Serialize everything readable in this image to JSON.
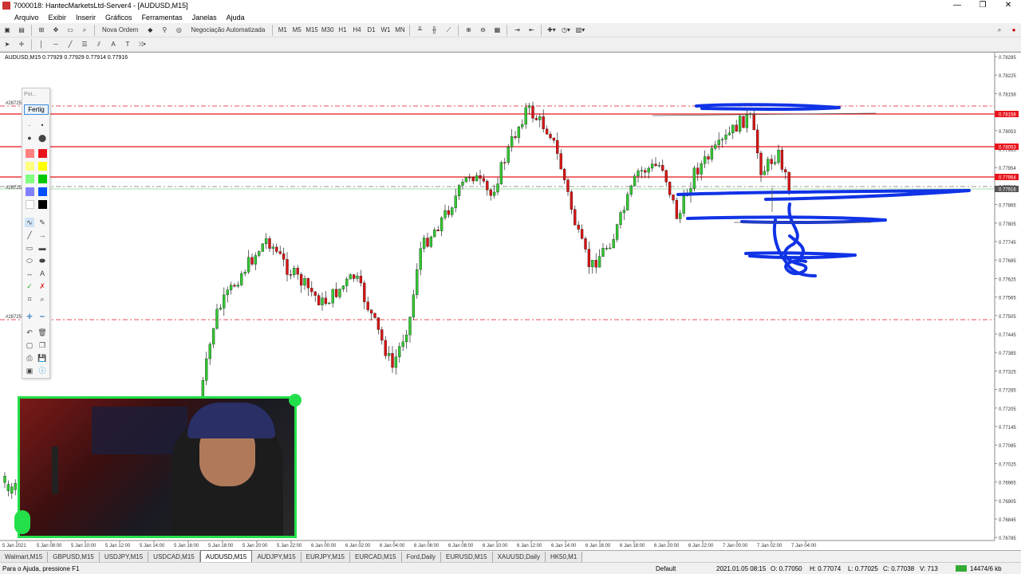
{
  "window": {
    "title": "7000018: HantecMarketsLtd-Server4 - [AUDUSD,M15]",
    "controls": [
      "—",
      "❐",
      "✕"
    ]
  },
  "menu": [
    "Arquivo",
    "Exibir",
    "Inserir",
    "Gráficos",
    "Ferramentas",
    "Janelas",
    "Ajuda"
  ],
  "toolbar": {
    "new_order": "Nova Ordem",
    "auto_trading": "Negociação Automatizada",
    "timeframes": [
      "M1",
      "M5",
      "M15",
      "M30",
      "H1",
      "H4",
      "D1",
      "W1",
      "MN"
    ]
  },
  "chart": {
    "header": "AUDUSD,M15  0.77929 0.77929 0.77914 0.77916",
    "price_labels": [
      "0.78285",
      "0.78225",
      "0.78158",
      "0.78105",
      "0.78053",
      "0.77985",
      "0.77954",
      "0.77916",
      "0.77865",
      "0.77805",
      "0.77745",
      "0.77685",
      "0.77625",
      "0.77565",
      "0.77505",
      "0.77445",
      "0.77385",
      "0.77325",
      "0.77265",
      "0.77205",
      "0.77145",
      "0.77085",
      "0.77025",
      "0.76965",
      "0.76905",
      "0.76845",
      "0.76785"
    ],
    "highlighted_prices": [
      {
        "text": "0.78158",
        "color": "#e8141b"
      },
      {
        "text": "0.78053",
        "color": "#e8141b"
      },
      {
        "text": "0.77954",
        "color": "#e8141b"
      },
      {
        "text": "0.77916",
        "color": "#555555"
      }
    ],
    "line_tags": [
      "#28725",
      "#28725",
      "#28725"
    ],
    "time_labels": [
      "5 Jan 2021",
      "5 Jan 08:00",
      "5 Jan 10:00",
      "5 Jan 12:00",
      "5 Jan 14:00",
      "5 Jan 16:00",
      "5 Jan 18:00",
      "5 Jan 20:00",
      "5 Jan 22:00",
      "6 Jan 00:00",
      "6 Jan 02:00",
      "6 Jan 04:00",
      "6 Jan 06:00",
      "6 Jan 08:00",
      "6 Jan 10:00",
      "6 Jan 12:00",
      "6 Jan 14:00",
      "6 Jan 16:00",
      "6 Jan 18:00",
      "6 Jan 20:00",
      "6 Jan 22:00",
      "7 Jan 00:00",
      "7 Jan 02:00",
      "7 Jan 04:00"
    ],
    "colors": {
      "bull": "#32c832",
      "bear": "#d81414",
      "level": "#e8141b",
      "drawing": "#1033e6"
    }
  },
  "palette": {
    "title": "Poi...",
    "done_label": "Fertig",
    "colors": [
      "#ff8080",
      "#e8141b",
      "#ffff80",
      "#ffff00",
      "#80ff80",
      "#00c800",
      "#8080ff",
      "#0050ff",
      "#ffffff",
      "#000000"
    ],
    "tools": [
      "pen-icon",
      "eraser-icon",
      "line-icon",
      "arrow-icon",
      "rect-icon",
      "filled-rect-icon",
      "ellipse-icon",
      "filled-ellipse-icon",
      "double-arrow-icon",
      "text-icon",
      "check-icon",
      "cross-icon",
      "crop-icon",
      "zoom-icon",
      "undo-icon",
      "trash-icon",
      "new-icon",
      "copy-icon",
      "print-icon",
      "save-icon",
      "screen-icon",
      "info-icon"
    ]
  },
  "tabs": [
    "Walmart,M15",
    "GBPUSD,M15",
    "USDJPY,M15",
    "USDCAD,M15",
    "AUDUSD,M15",
    "AUDJPY,M15",
    "EURJPY,M15",
    "EURCAD,M15",
    "Ford,Daily",
    "EURUSD,M15",
    "XAUUSD,Daily",
    "HK50,M1"
  ],
  "active_tab": "AUDUSD,M15",
  "status": {
    "help": "Para o Ajuda, pressione F1",
    "profile": "Default",
    "datetime": "2021.01.05 08:15",
    "open": "O: 0.77050",
    "high": "H: 0.77074",
    "low": "L: 0.77025",
    "close": "C: 0.77038",
    "volume": "V: 713",
    "connection": "14474/6 kb"
  }
}
